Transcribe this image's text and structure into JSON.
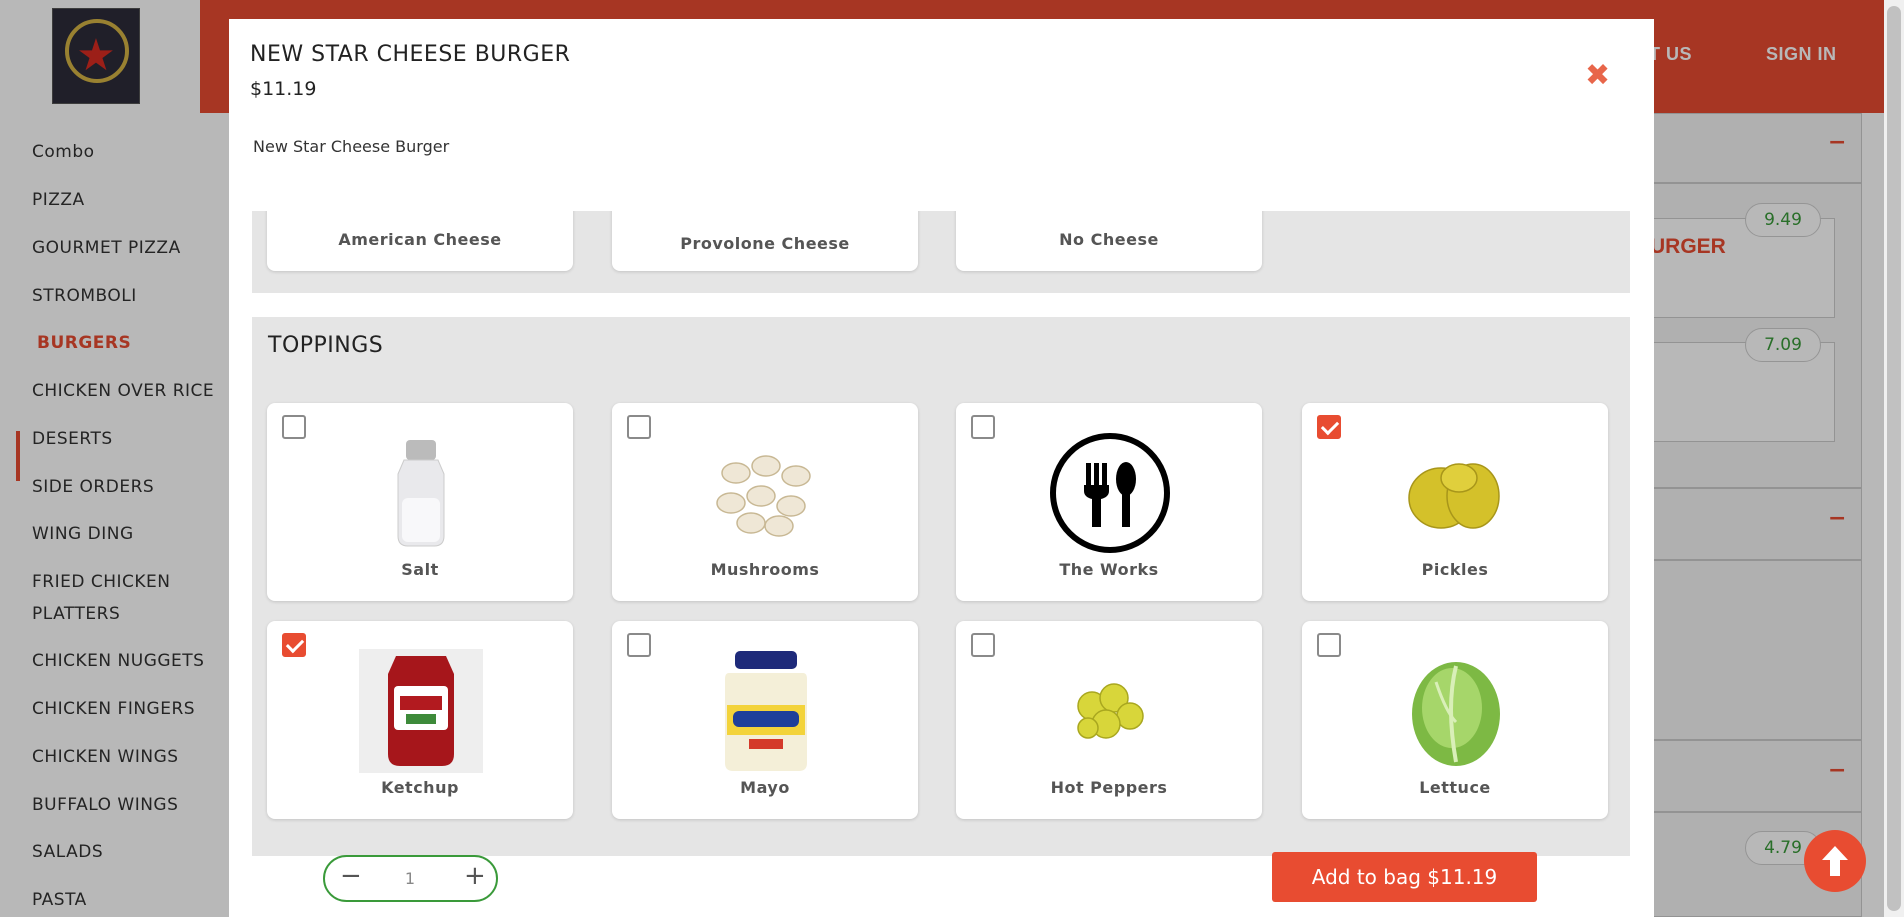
{
  "header": {
    "nav": [
      "ACT US",
      "SIGN IN"
    ]
  },
  "sidebar": {
    "items": [
      {
        "label": "Combo"
      },
      {
        "label": "PIZZA"
      },
      {
        "label": "GOURMET PIZZA"
      },
      {
        "label": "STROMBOLI"
      },
      {
        "label": "BURGERS",
        "active": true
      },
      {
        "label": "CHICKEN OVER RICE"
      },
      {
        "label": "DESERTS"
      },
      {
        "label": "SIDE ORDERS"
      },
      {
        "label": "WING DING"
      },
      {
        "label": "FRIED CHICKEN"
      },
      {
        "label": "PLATTERS"
      },
      {
        "label": "CHICKEN NUGGETS"
      },
      {
        "label": "CHICKEN FINGERS"
      },
      {
        "label": "CHICKEN WINGS"
      },
      {
        "label": "BUFFALO WINGS"
      },
      {
        "label": "SALADS"
      },
      {
        "label": "PASTA"
      }
    ]
  },
  "background": {
    "item_title_fragment": "URGER",
    "prices": [
      "9.49",
      "7.09",
      "4.79"
    ]
  },
  "modal": {
    "title": "NEW STAR CHEESE BURGER",
    "price": "$11.19",
    "description": "New Star Cheese Burger",
    "cheese_options": [
      {
        "label": "American Cheese"
      },
      {
        "label": "Provolone Cheese"
      },
      {
        "label": "No Cheese"
      }
    ],
    "toppings_title": "TOPPINGS",
    "toppings": [
      {
        "label": "Salt",
        "checked": false,
        "icon": "salt-shaker-icon"
      },
      {
        "label": "Mushrooms",
        "checked": false,
        "icon": "mushrooms-icon"
      },
      {
        "label": "The Works",
        "checked": false,
        "icon": "fork-spoon-icon"
      },
      {
        "label": "Pickles",
        "checked": true,
        "icon": "pickles-icon"
      },
      {
        "label": "Ketchup",
        "checked": true,
        "icon": "ketchup-bottle-icon"
      },
      {
        "label": "Mayo",
        "checked": false,
        "icon": "mayo-jar-icon"
      },
      {
        "label": "Hot Peppers",
        "checked": false,
        "icon": "hot-peppers-icon"
      },
      {
        "label": "Lettuce",
        "checked": false,
        "icon": "lettuce-icon"
      }
    ],
    "quantity": "1",
    "add_to_bag_label": "Add to bag $11.19"
  },
  "colors": {
    "accent": "#e84c31",
    "quantity_border": "#3a9a3a"
  }
}
